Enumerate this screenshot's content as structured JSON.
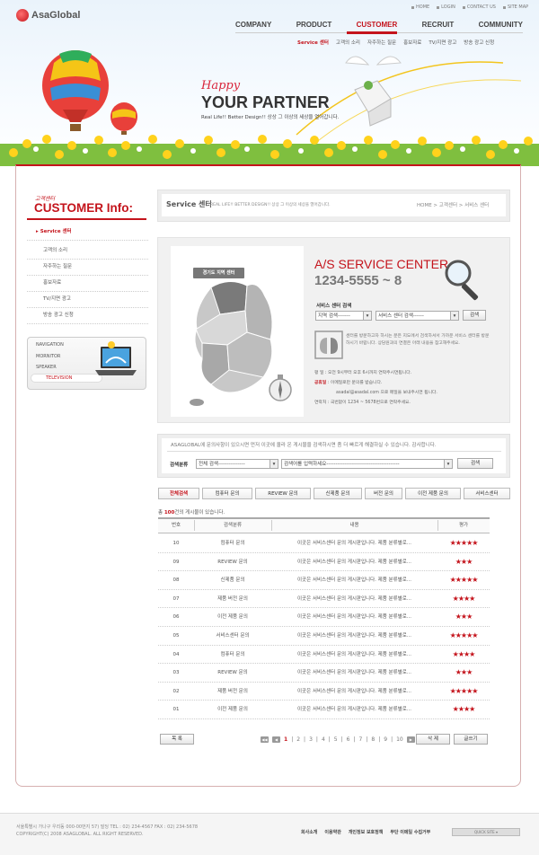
{
  "brand": {
    "logo_text": "AsaGlobal"
  },
  "util_nav": [
    "HOME",
    "LOGIN",
    "CONTACT US",
    "SITE MAP"
  ],
  "gnb": [
    "COMPANY",
    "PRODUCT",
    "CUSTOMER",
    "RECRUIT",
    "COMMUNITY"
  ],
  "subnav": [
    "Service 센터",
    "고객의 소리",
    "자주하는 질문",
    "홍보자료",
    "TV/지면 광고",
    "방송 광고 신청"
  ],
  "banner": {
    "happy": "Happy",
    "partner": "YOUR PARTNER",
    "tagline": "Real Life!! Better Design!! 상상 그 이상의 세상을 열어갑니다."
  },
  "lnb": {
    "title_small": "고객센터",
    "title": "CUSTOMER Info:",
    "items": [
      "Service 센터",
      "고객의 소리",
      "자주하는 질문",
      "홍보자료",
      "TV/지면 광고",
      "방송 광고 신청"
    ]
  },
  "sidebox": {
    "items": [
      "NAVIGATION",
      "MORNITOR",
      "SPEAKER",
      "TELEVISION"
    ]
  },
  "titlebar": {
    "title": "Service 센터",
    "subtitle": "REAL LIFE!! BETTER DESIGN!! 상상 그 이상의 세상을 열어갑니다.",
    "breadcrumb": "HOME > 고객센터 > 서비스 센터"
  },
  "as_center": {
    "map_label": "경기도 지역 센터",
    "title": "A/S SERVICE CENTER",
    "phone": "1234-5555 ~ 8",
    "search_label": "서비스 센터 검색",
    "region_select": "지역 검색-------",
    "center_select": "서비스 센터 검색------",
    "search_button": "검색",
    "desc": "센터를 방문하고자 하시는 분은 지도에서 검색하셔서 가까운 서비스 센터를 방문하시기 바랍니다. 상담원과의 연결은 아래 내용을 참고해주세요.",
    "hours": "평   일 : 오전 9시부터 오후 6시까지 연락주시면됩니다.",
    "holiday_label": "공휴일",
    "holiday": " : 이메일로만 문의를 받습니다.",
    "email": "asadal@asadal.com 으로 메일을 보내주시면 됩니다.",
    "contact": "연락처 : 국번없이 1234 ~ 5678번으로 연락주세요."
  },
  "search": {
    "message": "ASAGLOBAL에 문의사항이 있으시면 먼저 이곳에 올라 온 게시물을 검색하시면 좀 더 빠르게 해결하실 수 있습니다. 감사합니다.",
    "label": "검색분류",
    "category_select": "전체 검색---------------",
    "keyword_select": "검색어를 입력하세요-----------------------------------------",
    "button": "검색"
  },
  "tabs": [
    "전체검색",
    "컴퓨터 문의",
    "REVIEW 문의",
    "신제품 문의",
    "버전 문의",
    "이전 제품 문의",
    "서비스센터"
  ],
  "count": {
    "prefix": "총 ",
    "number": "100",
    "suffix": "건의 게시물이 있습니다."
  },
  "table": {
    "headers": [
      "번호",
      "검색분류",
      "내용",
      "평가"
    ],
    "rows": [
      {
        "no": "10",
        "category": "컴퓨터 문의",
        "content": "이곳은 서비스센터 문의 게시판입니다. 제품 분류별로...",
        "stars": "★★★★★"
      },
      {
        "no": "09",
        "category": "REVIEW 문의",
        "content": "이곳은 서비스센터 문의 게시판입니다. 제품 분류별로...",
        "stars": "★★★"
      },
      {
        "no": "08",
        "category": "신제품 문의",
        "content": "이곳은 서비스센터 문의 게시판입니다. 제품 분류별로...",
        "stars": "★★★★★"
      },
      {
        "no": "07",
        "category": "제품 버전 문의",
        "content": "이곳은 서비스센터 문의 게시판입니다. 제품 분류별로...",
        "stars": "★★★★"
      },
      {
        "no": "06",
        "category": "이전 제품 문의",
        "content": "이곳은 서비스센터 문의 게시판입니다. 제품 분류별로...",
        "stars": "★★★"
      },
      {
        "no": "05",
        "category": "서비스센터 문의",
        "content": "이곳은 서비스센터 문의 게시판입니다. 제품 분류별로...",
        "stars": "★★★★★"
      },
      {
        "no": "04",
        "category": "컴퓨터 문의",
        "content": "이곳은 서비스센터 문의 게시판입니다. 제품 분류별로...",
        "stars": "★★★★"
      },
      {
        "no": "03",
        "category": "REVIEW 문의",
        "content": "이곳은 서비스센터 문의 게시판입니다. 제품 분류별로...",
        "stars": "★★★"
      },
      {
        "no": "02",
        "category": "제품 버전 문의",
        "content": "이곳은 서비스센터 문의 게시판입니다. 제품 분류별로...",
        "stars": "★★★★★"
      },
      {
        "no": "01",
        "category": "이전 제품 문의",
        "content": "이곳은 서비스센터 문의 게시판입니다. 제품 분류별로...",
        "stars": "★★★★"
      }
    ]
  },
  "pager": {
    "pages": [
      "1",
      "2",
      "3",
      "4",
      "5",
      "6",
      "7",
      "8",
      "9",
      "10"
    ],
    "current": "1",
    "list_button": "목 록",
    "delete_button": "삭 제",
    "write_button": "글쓰기"
  },
  "footer": {
    "address": "서울특별시 가나구 우리동 000-00번지 57) 빌딩  TEL : 02) 234-4567  FAX : 02) 234-5678",
    "copyright": "COPYRIGHT(C) 2008 ASAGLOBAL. ALL RIGHT RESERVED.",
    "links": [
      "회사소개",
      "이용약관",
      "개인정보 보호정책",
      "무단 이메일 수집거부"
    ],
    "quick_site": "QUICK SITE"
  },
  "colors": {
    "accent": "#c4141c",
    "panel": "#eeeeee"
  }
}
